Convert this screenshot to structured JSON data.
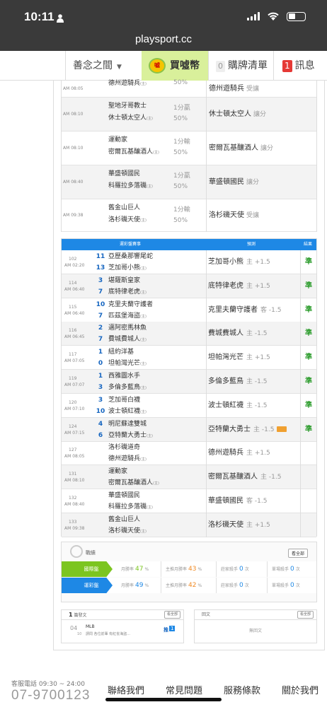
{
  "status": {
    "time": "10:11",
    "url": "playsport.cc"
  },
  "nav": {
    "user": "善念之間",
    "buy": "買噓幣",
    "coin_label": "噓",
    "cart_count": "0",
    "cart": "購牌清單",
    "msg_count": "1",
    "msg": "訊息"
  },
  "top_table": [
    {
      "time": "AM 08:05",
      "teams": [
        "",
        "德州遊騎兵"
      ],
      "tags": [
        "",
        "(主)"
      ],
      "line": [
        "",
        "50%"
      ],
      "pick": "德州遊騎兵",
      "side": "受讓"
    },
    {
      "time": "AM 08:10",
      "teams": [
        "聖地牙哥教士",
        "休士頓太空人"
      ],
      "tags": [
        "",
        "(主)"
      ],
      "line": [
        "1分贏",
        "50%"
      ],
      "pick": "休士頓太空人",
      "side": "讓分"
    },
    {
      "time": "AM 08:10",
      "teams": [
        "運動家",
        "密爾瓦基釀酒人"
      ],
      "tags": [
        "",
        "(主)"
      ],
      "line": [
        "1分輸",
        "50%"
      ],
      "pick": "密爾瓦基釀酒人",
      "side": "讓分"
    },
    {
      "time": "AM 08:40",
      "teams": [
        "華盛頓國民",
        "科羅拉多落磯"
      ],
      "tags": [
        "",
        "(主)"
      ],
      "line": [
        "1分贏",
        "50%"
      ],
      "pick": "華盛頓國民",
      "side": "讓分"
    },
    {
      "time": "AM 09:38",
      "teams": [
        "舊金山巨人",
        "洛杉磯天使"
      ],
      "tags": [
        "",
        "(主)"
      ],
      "line": [
        "1分輸",
        "50%"
      ],
      "pick": "洛杉磯天使",
      "side": "受讓"
    }
  ],
  "table2": {
    "headers": [
      "運彩盤賽事",
      "預測",
      "結果"
    ],
    "rows": [
      {
        "num": "102",
        "time": "AM 02:20",
        "s1": "11",
        "s2": "13",
        "teams": [
          "亞歷桑那響尾蛇",
          "芝加哥小熊"
        ],
        "pick": "芝加哥小熊",
        "side": "主 +1.5",
        "result": "準",
        "fire": false
      },
      {
        "num": "114",
        "time": "AM 06:40",
        "s1": "3",
        "s2": "7",
        "teams": [
          "堪薩斯皇家",
          "底特律老虎"
        ],
        "pick": "底特律老虎",
        "side": "主 +1.5",
        "result": "準",
        "fire": false
      },
      {
        "num": "115",
        "time": "AM 06:40",
        "s1": "10",
        "s2": "7",
        "teams": [
          "克里夫蘭守護者",
          "匹茲堡海盜"
        ],
        "pick": "克里夫蘭守護者",
        "side": "客 -1.5",
        "result": "準",
        "fire": false
      },
      {
        "num": "116",
        "time": "AM 06:45",
        "s1": "2",
        "s2": "7",
        "teams": [
          "邁阿密馬林魚",
          "費城費城人"
        ],
        "pick": "費城費城人",
        "side": "主 -1.5",
        "result": "準",
        "fire": false
      },
      {
        "num": "117",
        "time": "AM 07:05",
        "s1": "1",
        "s2": "0",
        "teams": [
          "紐約洋基",
          "坦帕灣光芒"
        ],
        "pick": "坦帕灣光芒",
        "side": "主 +1.5",
        "result": "準",
        "fire": false
      },
      {
        "num": "119",
        "time": "AM 07:07",
        "s1": "1",
        "s2": "3",
        "teams": [
          "西雅圖水手",
          "多倫多藍鳥"
        ],
        "pick": "多倫多藍鳥",
        "side": "主 -1.5",
        "result": "準",
        "fire": false
      },
      {
        "num": "120",
        "time": "AM 07:10",
        "s1": "3",
        "s2": "10",
        "teams": [
          "芝加哥白襪",
          "波士頓紅襪"
        ],
        "pick": "波士頓紅襪",
        "side": "主 -1.5",
        "result": "準",
        "fire": false
      },
      {
        "num": "124",
        "time": "AM 07:15",
        "s1": "4",
        "s2": "6",
        "teams": [
          "明尼蘇達雙城",
          "亞特蘭大勇士"
        ],
        "pick": "亞特蘭大勇士",
        "side": "主 -1.5",
        "result": "準",
        "fire": true
      },
      {
        "num": "127",
        "time": "AM 08:05",
        "s1": "",
        "s2": "",
        "teams": [
          "洛杉磯道奇",
          "德州遊騎兵"
        ],
        "pick": "德州遊騎兵",
        "side": "主 +1.5",
        "result": "",
        "fire": false
      },
      {
        "num": "131",
        "time": "AM 08:10",
        "s1": "",
        "s2": "",
        "teams": [
          "運動家",
          "密爾瓦基釀酒人"
        ],
        "pick": "密爾瓦基釀酒人",
        "side": "主 -1.5",
        "result": "",
        "fire": false
      },
      {
        "num": "132",
        "time": "AM 08:40",
        "s1": "",
        "s2": "",
        "teams": [
          "華盛頓國民",
          "科羅拉多落磯"
        ],
        "pick": "華盛頓國民",
        "side": "客 -1.5",
        "result": "",
        "fire": false
      },
      {
        "num": "133",
        "time": "AM 09:38",
        "s1": "",
        "s2": "",
        "teams": [
          "舊金山巨人",
          "洛杉磯天使"
        ],
        "pick": "洛杉磯天使",
        "side": "主 +1.5",
        "result": "",
        "fire": false
      }
    ]
  },
  "stats": {
    "title": "戰績",
    "all": "看全部",
    "rows": [
      {
        "label": "國際盤",
        "color": "#7cc520",
        "c1_label": "月勝率",
        "c1_val": "47",
        "c1_unit": "%",
        "c2_label": "主推月勝率",
        "c2_val": "43",
        "c2_unit": "%",
        "c3_label": "莊家殺手",
        "c3_val": "0",
        "c3_unit": "次",
        "c4_label": "單場殺手",
        "c4_val": "0",
        "c4_unit": "次"
      },
      {
        "label": "運彩盤",
        "color": "#1e88e5",
        "c1_label": "月勝率",
        "c1_val": "49",
        "c1_unit": "%",
        "c2_label": "主推月勝率",
        "c2_val": "42",
        "c2_unit": "%",
        "c3_label": "莊家殺手",
        "c3_val": "0",
        "c3_unit": "次",
        "c4_label": "單場殺手",
        "c4_val": "0",
        "c4_unit": "次"
      }
    ]
  },
  "posts": {
    "count": "1",
    "title": "篇發文",
    "more": "看全部",
    "date": "04",
    "date_sub": "10",
    "league": "MLB",
    "text": "請問 各位前輩 有紅雀海盜...",
    "badge_label": "推",
    "badge_num": "1"
  },
  "replies": {
    "title": "回文",
    "more": "看全部",
    "empty": "無回文"
  },
  "footer": {
    "service": "客服電話 09:30 ~ 24:00",
    "tel": "07-9700123",
    "links": [
      "聯絡我們",
      "常見問題",
      "服務條款",
      "關於我們"
    ]
  }
}
